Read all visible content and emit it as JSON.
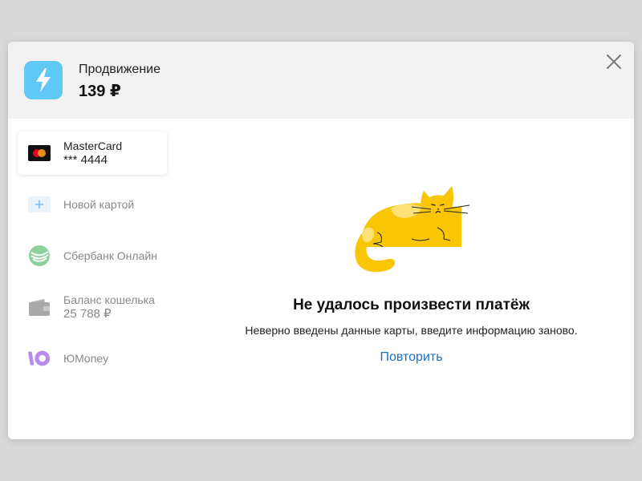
{
  "header": {
    "title": "Продвижение",
    "price": "139 ₽",
    "icon": "lightning-icon",
    "icon_bg": "#5fc8f5"
  },
  "close": {
    "icon": "close-icon"
  },
  "payment_methods": [
    {
      "label": "MasterCard",
      "sub": "*** 4444",
      "icon": "mastercard-icon",
      "active": true
    },
    {
      "label": "Новой картой",
      "icon": "plus-icon",
      "active": false
    },
    {
      "label": "Сбербанк Онлайн",
      "icon": "sberbank-icon",
      "active": false
    },
    {
      "label": "Баланс кошелька",
      "sub": "25 788 ₽",
      "icon": "wallet-icon",
      "active": false
    },
    {
      "label": "ЮMoney",
      "icon": "yumoney-icon",
      "active": false
    }
  ],
  "error": {
    "title": "Не удалось произвести платёж",
    "description": "Неверно введены данные карты, введите информацию заново.",
    "retry": "Повторить"
  },
  "colors": {
    "link": "#1a6fc9",
    "cat": "#f9c606"
  }
}
